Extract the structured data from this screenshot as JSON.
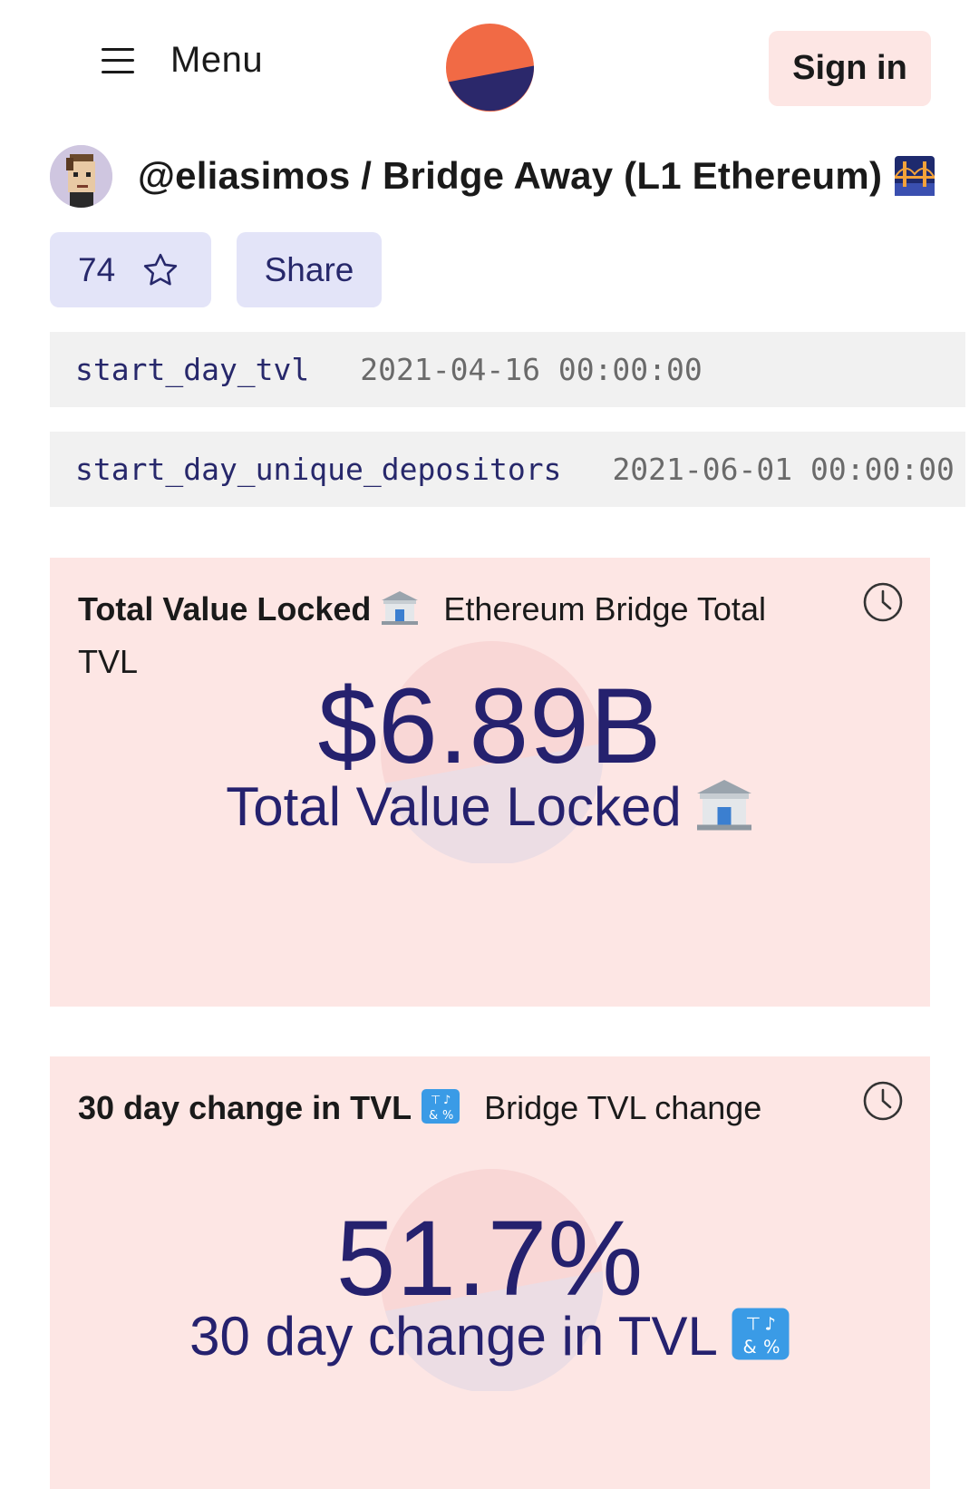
{
  "header": {
    "menu_label": "Menu",
    "signin_label": "Sign in",
    "logo_colors": {
      "top": "#f16a45",
      "bottom": "#2b286b"
    }
  },
  "dashboard": {
    "title": "@eliasimos / Bridge Away (L1 Ethereum)",
    "title_emoji": "bridge-at-night",
    "star_count": "74",
    "share_label": "Share"
  },
  "params": [
    {
      "name": "start_day_tvl",
      "value": "2021-04-16 00:00:00"
    },
    {
      "name": "start_day_unique_depositors",
      "value": "2021-06-01 00:00:00"
    }
  ],
  "cards": [
    {
      "title": "Total Value Locked",
      "title_emoji": "bank",
      "subtitle": "Ethereum Bridge Total TVL",
      "value": "$6.89B",
      "label": "Total Value Locked"
    },
    {
      "title": "30 day change in TVL",
      "title_emoji": "input-symbols",
      "subtitle": "Bridge TVL change",
      "value": "51.7%",
      "label": "30 day change in TVL"
    }
  ],
  "colors": {
    "accent_dark": "#25216e",
    "card_bg": "#fde6e4",
    "button_bg": "#e3e4f8",
    "param_bg": "#f1f1f1"
  }
}
